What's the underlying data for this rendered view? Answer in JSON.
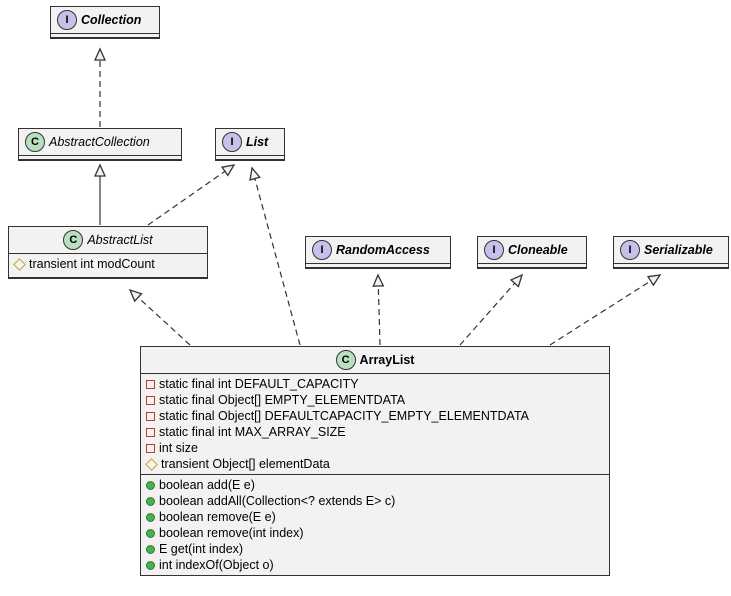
{
  "classes": {
    "collection": {
      "name": "Collection",
      "type": "I"
    },
    "abstractCollection": {
      "name": "AbstractCollection",
      "type": "C"
    },
    "list": {
      "name": "List",
      "type": "I"
    },
    "abstractList": {
      "name": "AbstractList",
      "type": "C",
      "fields": [
        "transient int modCount"
      ]
    },
    "randomAccess": {
      "name": "RandomAccess",
      "type": "I"
    },
    "cloneable": {
      "name": "Cloneable",
      "type": "I"
    },
    "serializable": {
      "name": "Serializable",
      "type": "I"
    },
    "arrayList": {
      "name": "ArrayList",
      "type": "C",
      "fields_private": [
        "static final int DEFAULT_CAPACITY",
        "static final Object[] EMPTY_ELEMENTDATA",
        "static final Object[] DEFAULTCAPACITY_EMPTY_ELEMENTDATA",
        "static final int MAX_ARRAY_SIZE",
        "int size"
      ],
      "fields_default": [
        "transient Object[] elementData"
      ],
      "methods": [
        "boolean add(E e)",
        "boolean addAll(Collection<? extends E> c)",
        "boolean remove(E e)",
        "boolean remove(int index)",
        "E get(int index)",
        "int indexOf(Object o)"
      ]
    }
  },
  "relationships": [
    {
      "from": "AbstractCollection",
      "to": "Collection",
      "style": "dashed"
    },
    {
      "from": "AbstractList",
      "to": "AbstractCollection",
      "style": "solid"
    },
    {
      "from": "AbstractList",
      "to": "List",
      "style": "dashed"
    },
    {
      "from": "ArrayList",
      "to": "AbstractList",
      "style": "dashed"
    },
    {
      "from": "ArrayList",
      "to": "List",
      "style": "dashed"
    },
    {
      "from": "ArrayList",
      "to": "RandomAccess",
      "style": "dashed"
    },
    {
      "from": "ArrayList",
      "to": "Cloneable",
      "style": "dashed"
    },
    {
      "from": "ArrayList",
      "to": "Serializable",
      "style": "dashed"
    }
  ]
}
